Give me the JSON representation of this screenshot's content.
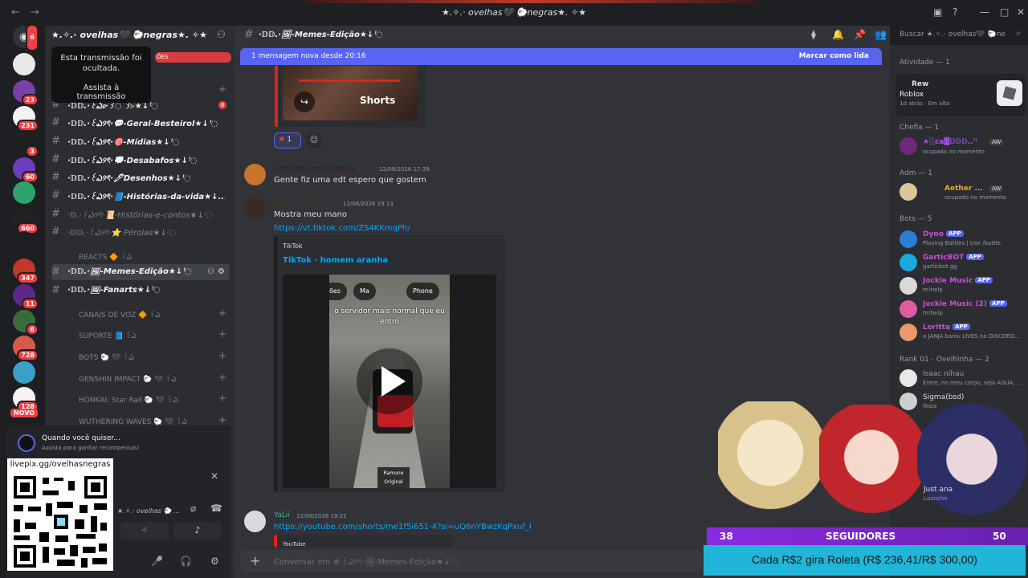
{
  "window": {
    "title": "★.✧.· ovelhas🖤 🐑negras★. ✧★"
  },
  "rail": {
    "badges": [
      "6",
      "23",
      "231",
      "3",
      "60",
      "660",
      "347",
      "11",
      "6",
      "728",
      "128"
    ],
    "novo_label": "NOVO"
  },
  "server": {
    "name": "★.✧.· ovelhas🖤 🐑negras★. ✧★"
  },
  "stream_tooltip": {
    "text": "Esta transmissão foi ocultada.",
    "button": "Assista à transmissão"
  },
  "channels": [
    {
      "name": "·𝔻𝔻.·꒰ఎ𝔬·꒱◌ ꒱▹★↓ꜝ◌",
      "badge": "8"
    },
    {
      "name": "·𝔻𝔻.·꒰ఎ୨ৎ·💬-Geral-Besteirol★↓ꜝ◌",
      "badge": ""
    },
    {
      "name": "·𝔻𝔻.·꒰ఎ୨ৎ·🎯-Mídias★↓ꜝ◌",
      "badge": ""
    },
    {
      "name": "·𝔻𝔻.·꒰ఎ୨ৎ·💭-Desabafos★↓ꜝ◌",
      "badge": ""
    },
    {
      "name": "·𝔻𝔻.·꒰ఎ୨ৎ·🖊Desenhos★↓ꜝ◌",
      "badge": ""
    },
    {
      "name": "·𝔻𝔻.·꒰ఎ୨ৎ·📘-Histórias-da-vida★↓...",
      "badge": ""
    },
    {
      "name": "·𝔻.·꒰ఎ୨ৎ·📜-Histórias-e-contos★↓ꜝ◌",
      "badge": ""
    },
    {
      "name": "·𝔻𝔻.·꒰ఎ୨ৎ·⭐ Pérolas★↓ꜝ◌",
      "badge": ""
    }
  ],
  "reacts_category": "REACTS 🔶 ꒰ఎ",
  "active_channels": [
    {
      "name": "·𝔻𝔻.·🖼-Memes-Edição★↓ꜝ◌"
    },
    {
      "name": "·𝔻𝔻.·🖼-Fanarts★↓ꜝ◌"
    }
  ],
  "categories": [
    "CANAIS DE VOZ 🔶 ꒰ఎ",
    "SUPORTE 📘 ꒰ఎ",
    "BOTS 🐑 🖤 ꒰ఎ",
    "GENSHIN IMPACT 🐑 🖤 ꒰ఎ",
    "HONKAI: Star Rail 🐑 🖤 ꒰ఎ",
    "WUTHERING WAVES 🐑 🖤 ꒰ఎ"
  ],
  "quest": {
    "title": "Quando você quiser...",
    "subtitle": "Assista para ganhar recompensas!"
  },
  "qr": {
    "url": "livepix.gg/ovelhasnegras"
  },
  "user_panel": {
    "name": "★.✧.· ovelhas 🐑 ..."
  },
  "channel_header": {
    "name": "·𝔻𝔻.·🖼-Memes-Edição★↓ꜝ◌",
    "search_placeholder": "Buscar ★.✧.· ovelhas🖤 🐑ne"
  },
  "new_messages": {
    "text": "1 mensagem nova desde 20:16",
    "action": "Marcar como lida"
  },
  "shorts": {
    "label": "Shorts"
  },
  "reaction": {
    "count": "1"
  },
  "messages": [
    {
      "author": "Coisinha com bolinhas",
      "time": "12/08/2026 17:39",
      "text": "Gente fiz uma edt espero que gostem",
      "link": ""
    },
    {
      "author": "Henrique Aranha",
      "time": "12/08/2026 19:13",
      "text": "Mostra meu mano",
      "link": "https://vt.tiktok.com/ZS4KKmqPh/"
    },
    {
      "author": "YaLii",
      "time": "12/08/2026 19:21",
      "text": "",
      "link": "https://youtube.com/shorts/me1f5i651-4?si=uQ6nYBwzKqPxuf_l"
    }
  ],
  "tiktok_embed": {
    "provider": "TikTok",
    "title": "TikTok · homem aranha",
    "pill_left": "ões",
    "pill_mid": "Ma",
    "pill_right": "Phone",
    "caption": "o servidor mais normal que eu entro",
    "footer": "Ramune Original"
  },
  "youtube_embed": {
    "provider": "YouTube"
  },
  "composer": {
    "placeholder": "Conversar em #·꒰ఎ୨ৎ·🖼-Memes-Edição★↓ꜝ◌"
  },
  "activity": {
    "section": "Atividade — 1",
    "user": "Rew",
    "game": "Roblox",
    "time": "1d atrás",
    "status": "Em alta"
  },
  "members": {
    "chefia_header": "Chefia — 1",
    "chefia": [
      {
        "name": "★░ca▓𝔻𝔻𝔻..ꜝꜞ",
        "tag": "AW",
        "sub": "ocupada no momento",
        "color": "#a855f7"
      }
    ],
    "adm_header": "Adm — 1",
    "adm": [
      {
        "name": "Aether ...",
        "tag": "AW",
        "sub": "ocupado no momento",
        "color": "#e5a83a"
      }
    ],
    "bots_header": "Bots — 5",
    "bots": [
      {
        "name": "Dyno",
        "sub": "Playing Battles | Use /battle",
        "color": "#c850d5"
      },
      {
        "name": "GarticBOT",
        "sub": "garticbot.gg",
        "color": "#c850d5"
      },
      {
        "name": "Jockie Music",
        "sub": "m!help",
        "color": "#c850d5"
      },
      {
        "name": "Jockie Music (2)",
        "sub": "m!help",
        "color": "#c850d5"
      },
      {
        "name": "Loritta",
        "sub": "a JANJA baniu LIVES no DISCORD...",
        "color": "#c850d5"
      }
    ],
    "app_tag": "APP",
    "rank_header": "Rank 01 - Ovelhinha — 2",
    "rank": [
      {
        "name": "Isaac nihau",
        "sub": "Entre, no meu corpo, seja AGUA, ...",
        "color": "#949ba4"
      },
      {
        "name": "Sigma(bsd)",
        "sub": "festa",
        "color": "#dbdee1"
      }
    ],
    "rank2_header": "k 0",
    "extra_user": "Just ana",
    "extra_sub": "Launche"
  },
  "stream_overlay": {
    "followers_current": "38",
    "followers_label": "SEGUIDORES",
    "followers_goal": "50",
    "roulette": "Cada R$2 gira Roleta (R$ 236,41/R$ 300,00)"
  }
}
